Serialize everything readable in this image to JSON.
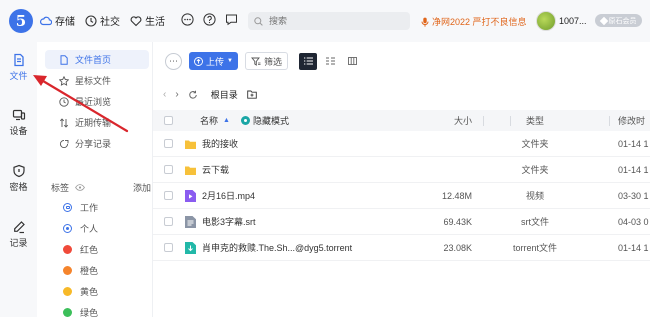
{
  "app": {
    "logo_text": "5"
  },
  "top_nav": [
    {
      "label": "存储",
      "icon": "cloud-icon"
    },
    {
      "label": "社交",
      "icon": "clock-icon"
    },
    {
      "label": "生活",
      "icon": "heart-icon"
    }
  ],
  "search": {
    "placeholder": "搜索"
  },
  "promo": {
    "text": "净网2022 严打不良信息"
  },
  "user": {
    "name": "1007...",
    "badge": "原石会员"
  },
  "rail": [
    {
      "label": "文件",
      "icon": "file-icon",
      "active": true
    },
    {
      "label": "设备",
      "icon": "device-icon",
      "active": false
    },
    {
      "label": "密格",
      "icon": "shield-icon",
      "active": false
    },
    {
      "label": "记录",
      "icon": "pen-icon",
      "active": false
    }
  ],
  "sidebar": {
    "items": [
      {
        "label": "文件首页",
        "icon": "file-home-icon",
        "active": true
      },
      {
        "label": "星标文件",
        "icon": "star-icon",
        "active": false
      },
      {
        "label": "最近浏览",
        "icon": "clock-icon",
        "active": false
      },
      {
        "label": "近期传输",
        "icon": "transfer-icon",
        "active": false
      },
      {
        "label": "分享记录",
        "icon": "share-icon",
        "active": false
      }
    ],
    "tags_title": "标签",
    "add_tag": "添加",
    "tags": [
      {
        "label": "工作",
        "color": "#3d73e8",
        "kind": "outline"
      },
      {
        "label": "个人",
        "color": "#3d73e8",
        "kind": "outline"
      },
      {
        "label": "红色",
        "color": "#f04a3a",
        "kind": "dot"
      },
      {
        "label": "橙色",
        "color": "#f5842c",
        "kind": "dot"
      },
      {
        "label": "黄色",
        "color": "#f7b928",
        "kind": "dot"
      },
      {
        "label": "绿色",
        "color": "#3cbf5a",
        "kind": "dot"
      }
    ]
  },
  "toolbar": {
    "upload_label": "上传",
    "filter_label": "筛选"
  },
  "path": {
    "current": "根目录"
  },
  "table": {
    "headers": {
      "name": "名称",
      "hidden_mode": "隐藏模式",
      "size": "大小",
      "type": "类型",
      "modified": "修改时"
    },
    "rows": [
      {
        "name": "我的接收",
        "size": "",
        "type": "文件夹",
        "modified": "01-14 1",
        "icon": "folder-icon"
      },
      {
        "name": "云下载",
        "size": "",
        "type": "文件夹",
        "modified": "01-14 1",
        "icon": "folder-icon"
      },
      {
        "name": "2月16日.mp4",
        "size": "12.48M",
        "type": "视频",
        "modified": "03-30 1",
        "icon": "video-file-icon"
      },
      {
        "name": "电影3字幕.srt",
        "size": "69.43K",
        "type": "srt文件",
        "modified": "04-03 0",
        "icon": "text-file-icon"
      },
      {
        "name": "肖申克的救赎.The.Sh...@dyg5.torrent",
        "size": "23.08K",
        "type": "torrent文件",
        "modified": "01-14 1",
        "icon": "torrent-file-icon"
      }
    ]
  },
  "colors": {
    "accent": "#3d73e8",
    "annotation": "#d9262c",
    "folder": "#f7c13a"
  }
}
